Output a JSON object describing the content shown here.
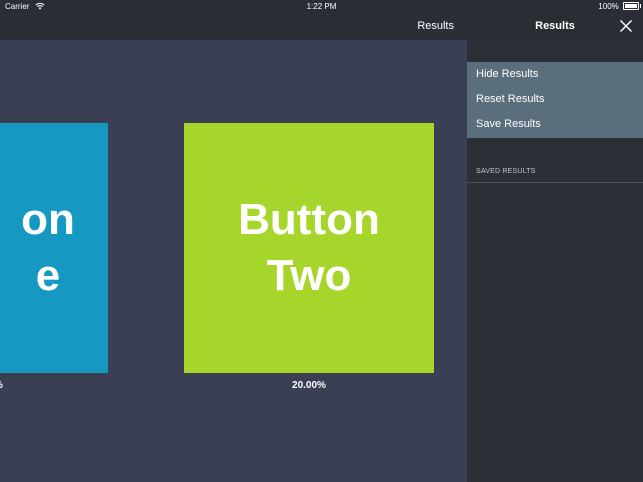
{
  "status_bar": {
    "carrier": "Carrier",
    "time": "1:22 PM",
    "battery": "100%"
  },
  "main": {
    "nav": {
      "results_label": "Results"
    },
    "tiles": [
      {
        "label": "Button\nOne",
        "visible_label": "on\ne",
        "percent": "%",
        "color": "#1599c3"
      },
      {
        "label": "Button\nTwo",
        "visible_label": "Button\nTwo",
        "percent": "20.00%",
        "color": "#a6d62b"
      }
    ]
  },
  "panel": {
    "title": "Results",
    "menu": [
      {
        "label": "Hide Results"
      },
      {
        "label": "Reset Results"
      },
      {
        "label": "Save Results"
      }
    ],
    "saved_section_label": "SAVED RESULTS"
  },
  "colors": {
    "background": "#3a3f53",
    "nav_bar": "#2b2e37",
    "panel": "#2d2f37",
    "panel_menu": "#5a6e7c"
  },
  "icons": {
    "close": "close-icon",
    "wifi": "wifi-icon",
    "battery": "battery-icon"
  }
}
